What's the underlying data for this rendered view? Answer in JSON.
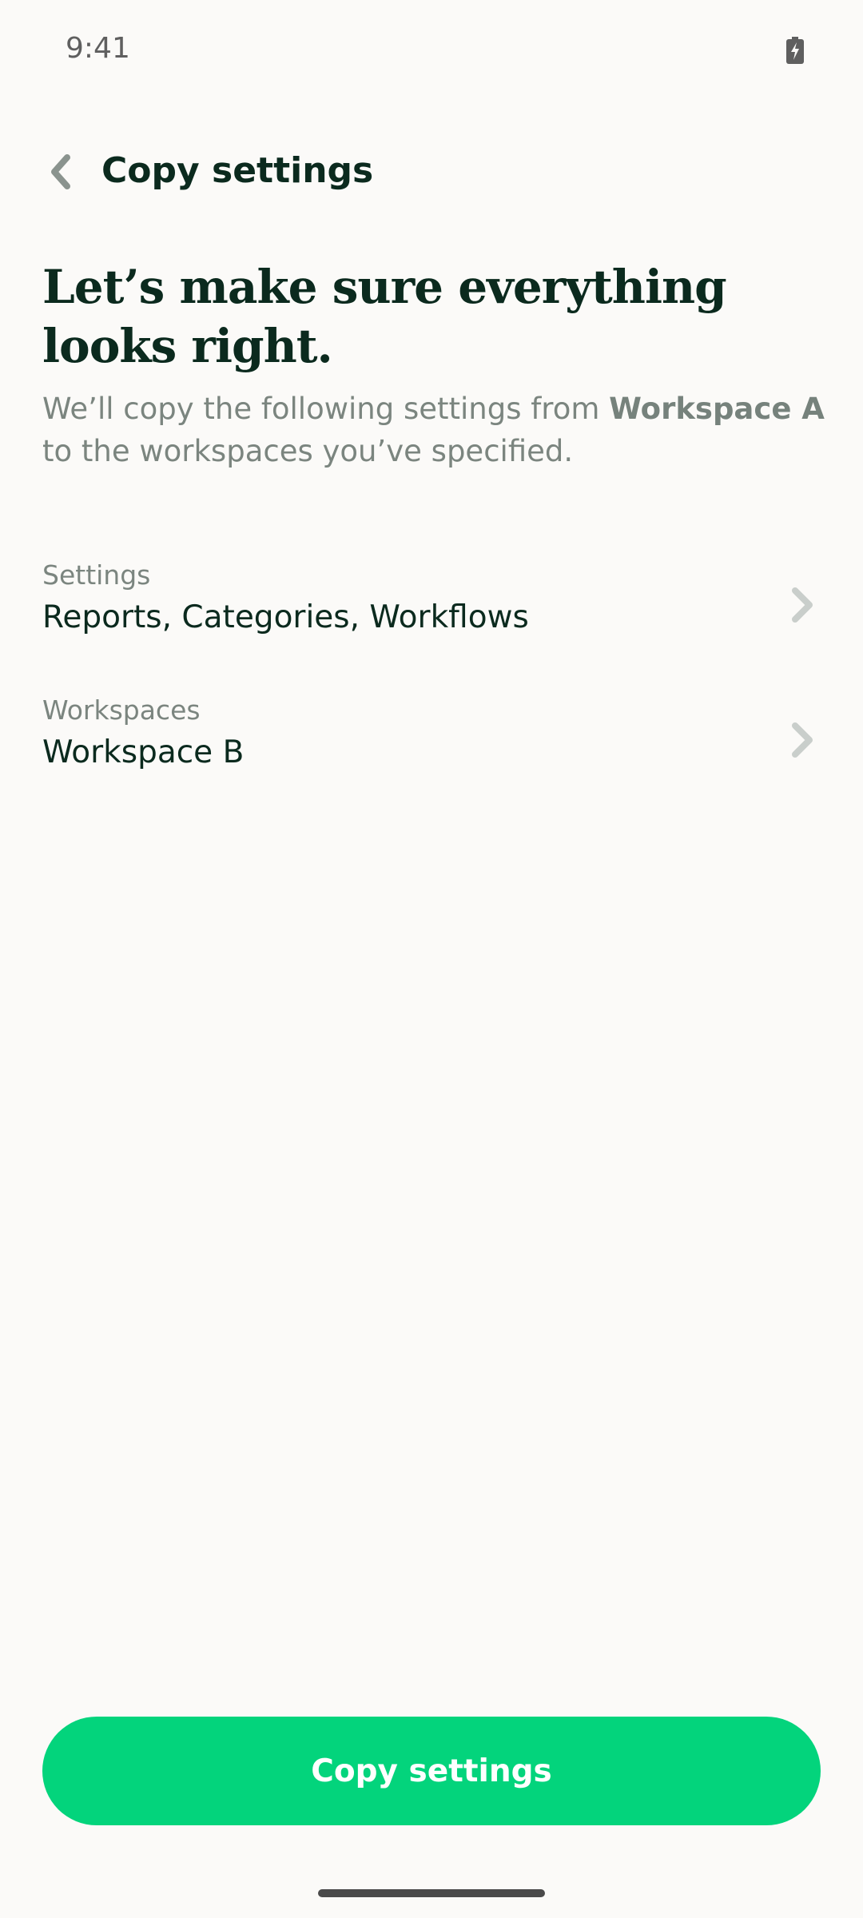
{
  "status_bar": {
    "time": "9:41",
    "battery_icon": "battery-charging-icon"
  },
  "header": {
    "back_icon": "chevron-left-icon",
    "title": "Copy settings"
  },
  "content": {
    "heading": "Let’s make sure everything looks right.",
    "description_prefix": "We’ll copy the following settings from ",
    "description_bold": "Workspace A",
    "description_suffix": " to the workspaces you’ve specified."
  },
  "rows": [
    {
      "label": "Settings",
      "value": "Reports, Categories, Workflows",
      "icon": "chevron-right-icon"
    },
    {
      "label": "Workspaces",
      "value": "Workspace B",
      "icon": "chevron-right-icon"
    }
  ],
  "footer": {
    "button_label": "Copy settings",
    "button_color": "#03D47C"
  },
  "colors": {
    "background": "#FBFAF8",
    "text_primary": "#0B2A1E",
    "text_secondary": "#7B857F",
    "accent": "#03D47C"
  }
}
